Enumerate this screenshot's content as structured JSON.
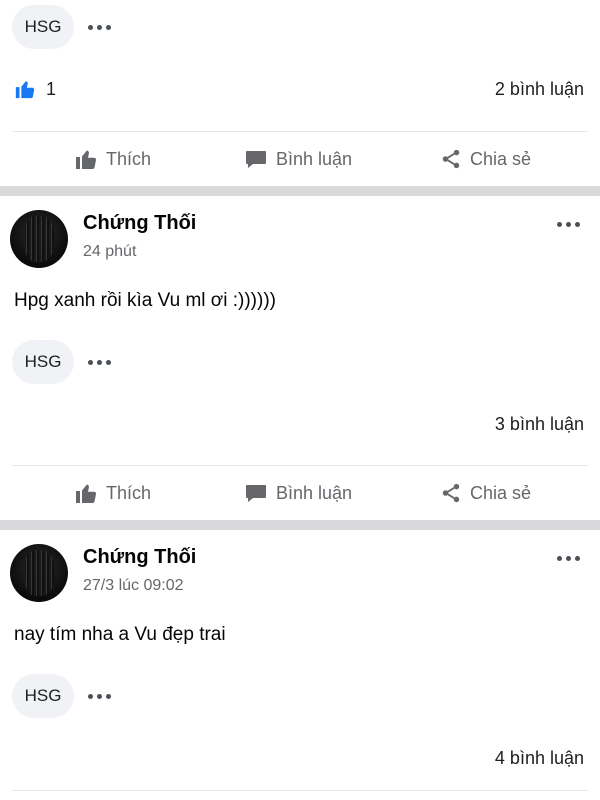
{
  "colors": {
    "like_blue": "#1877f2",
    "icon_gray": "#65676b",
    "separator": "#d9d9db",
    "chip_bg": "#f0f2f5"
  },
  "actions": {
    "like_label": "Thích",
    "comment_label": "Bình luận",
    "share_label": "Chia sẻ",
    "like_icon": "thumbs-up-icon",
    "comment_icon": "speech-bubble-icon",
    "share_icon": "share-icon"
  },
  "top_post": {
    "tag": "HSG",
    "like_count": "1",
    "comment_count": "2 bình luận"
  },
  "posts": [
    {
      "author": "Chứng Thối",
      "time": "24 phút",
      "text": "Hpg xanh rồi kìa Vu ml ơi :))))))",
      "tag": "HSG",
      "comment_count": "3 bình luận"
    },
    {
      "author": "Chứng Thối",
      "time": "27/3 lúc 09:02",
      "text": "nay tím nha a Vu đẹp trai",
      "tag": "HSG",
      "comment_count": "4 bình luận"
    }
  ]
}
